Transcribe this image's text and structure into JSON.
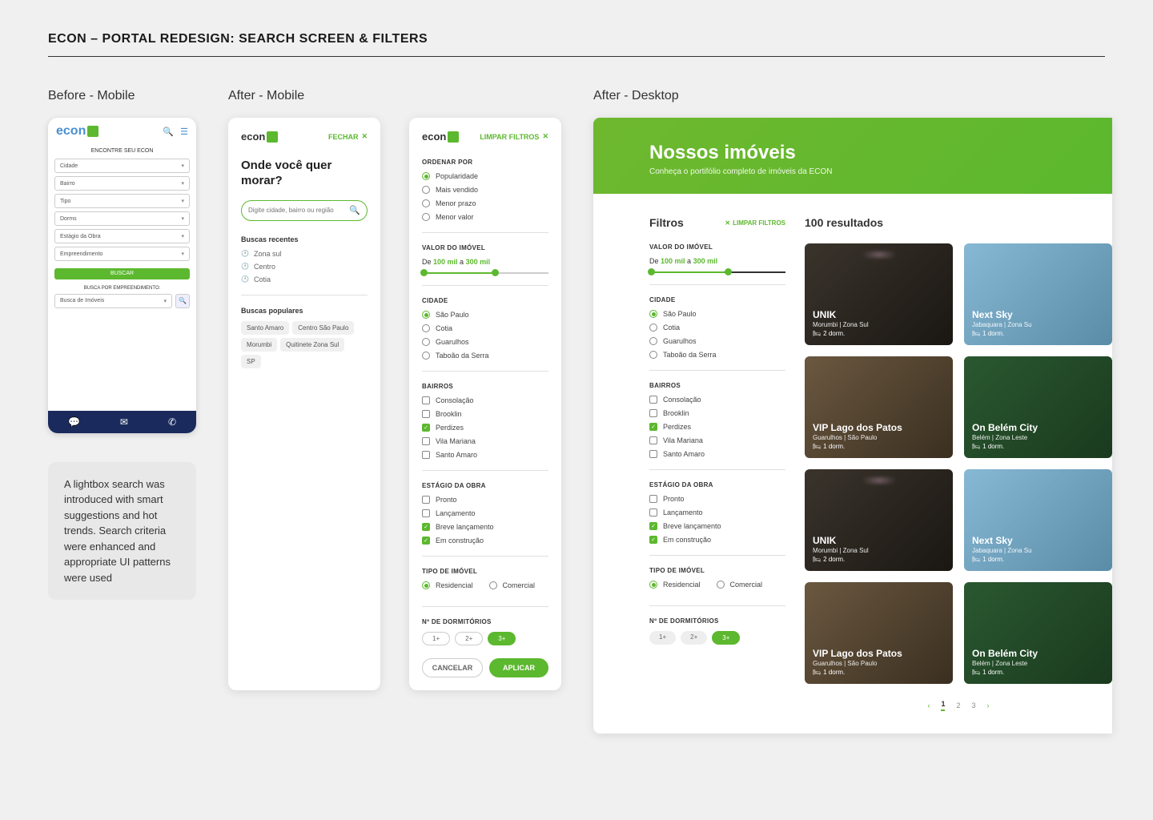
{
  "page_title": "ECON – PORTAL REDESIGN: SEARCH SCREEN & FILTERS",
  "columns": {
    "before_mobile": "Before - Mobile",
    "after_mobile": "After - Mobile",
    "after_desktop": "After - Desktop"
  },
  "caption": "A lightbox search was introduced with smart suggestions and hot trends. Search criteria were enhanced and appropriate UI patterns were used",
  "brand": "econ",
  "before": {
    "heading": "ENCONTRE SEU ECON",
    "selects": [
      "Cidade",
      "Bairro",
      "Tipo",
      "Dorms",
      "Estágio da Obra",
      "Empreendimento"
    ],
    "button": "BUSCAR",
    "sub": "BUSCA POR EMPREENDIMENTO:",
    "search_placeholder": "Busca de Imóveis"
  },
  "after_search": {
    "close": "FECHAR",
    "heading": "Onde você quer morar?",
    "placeholder": "Digite cidade, bairro ou região",
    "recent_label": "Buscas recentes",
    "recent": [
      "Zona sul",
      "Centro",
      "Cotia"
    ],
    "popular_label": "Buscas populares",
    "popular": [
      "Santo Amaro",
      "Centro São Paulo",
      "Morumbi",
      "Quitinete Zona Sul",
      "SP"
    ]
  },
  "filters": {
    "clear": "LIMPAR FILTROS",
    "sort_label": "ORDENAR POR",
    "sort_opts": [
      "Popularidade",
      "Mais vendido",
      "Menor prazo",
      "Menor valor"
    ],
    "sort_selected": 0,
    "value_label": "VALOR DO IMÓVEL",
    "value_prefix": "De ",
    "value_min": "100 mil",
    "value_mid": " a ",
    "value_max": "300 mil",
    "city_label": "CIDADE",
    "cities": [
      "São Paulo",
      "Cotia",
      "Guarulhos",
      "Taboão da Serra"
    ],
    "city_selected": 0,
    "neigh_label": "BAIRROS",
    "neighs": [
      "Consolação",
      "Brooklin",
      "Perdizes",
      "Vila Mariana",
      "Santo Amaro"
    ],
    "neigh_checked": [
      2
    ],
    "stage_label": "ESTÁGIO DA OBRA",
    "stages": [
      "Pronto",
      "Lançamento",
      "Breve lançamento",
      "Em construção"
    ],
    "stage_checked": [
      2,
      3
    ],
    "type_label": "TIPO DE IMÓVEL",
    "types": [
      "Residencial",
      "Comercial"
    ],
    "type_selected": 0,
    "dorm_label": "Nº DE DORMITÓRIOS",
    "dorm_opts": [
      "1+",
      "2+",
      "3+"
    ],
    "dorm_selected": 2,
    "cancel": "CANCELAR",
    "apply": "APLICAR"
  },
  "desktop": {
    "hero_title": "Nossos imóveis",
    "hero_sub": "Conheça o portifólio completo de imóveis da ECON",
    "filters_title": "Filtros",
    "results_title": "100 resultados",
    "cards": [
      {
        "title": "UNIK",
        "loc": "Morumbi | Zona Sul",
        "dorm": "2 dorm."
      },
      {
        "title": "Next Sky",
        "loc": "Jabaquara | Zona Su",
        "dorm": "1 dorm."
      },
      {
        "title": "VIP Lago dos Patos",
        "loc": "Guarulhos | São Paulo",
        "dorm": "1 dorm."
      },
      {
        "title": "On Belém City",
        "loc": "Belém | Zona Leste",
        "dorm": "1 dorm."
      },
      {
        "title": "UNIK",
        "loc": "Morumbi | Zona Sul",
        "dorm": "2 dorm."
      },
      {
        "title": "Next Sky",
        "loc": "Jabaquara | Zona Su",
        "dorm": "1 dorm."
      },
      {
        "title": "VIP Lago dos Patos",
        "loc": "Guarulhos | São Paulo",
        "dorm": "1 dorm."
      },
      {
        "title": "On Belém City",
        "loc": "Belém | Zona Leste",
        "dorm": "1 dorm."
      }
    ],
    "pagination": [
      "1",
      "2",
      "3"
    ]
  }
}
